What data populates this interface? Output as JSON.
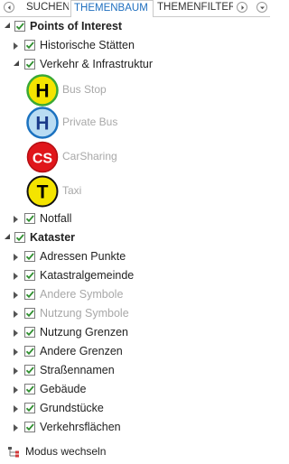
{
  "tabs": [
    {
      "label": "SUCHEN",
      "active": false
    },
    {
      "label": "THEMENBAUM",
      "active": true
    },
    {
      "label": "THEMENFILTER",
      "active": false
    }
  ],
  "tree": {
    "poi": {
      "label": "Points of Interest",
      "checked": true,
      "children": {
        "historic": {
          "label": "Historische Stätten",
          "checked": true
        },
        "traffic": {
          "label": "Verkehr & Infrastruktur",
          "checked": true,
          "legend": [
            {
              "symbol": "H",
              "label": "Bus Stop",
              "fill": "#f4e400",
              "ring": "#3aa935",
              "text_color": "#000000"
            },
            {
              "symbol": "H",
              "label": "Private Bus",
              "fill": "#b9dcf3",
              "ring": "#1b72c0",
              "text_color": "#1a3a8a"
            },
            {
              "symbol": "CS",
              "label": "CarSharing",
              "fill": "#e0161b",
              "ring": "#b50e12",
              "text_color": "#ffffff"
            },
            {
              "symbol": "T",
              "label": "Taxi",
              "fill": "#f4e400",
              "ring": "#111111",
              "text_color": "#000000"
            }
          ]
        },
        "emergency": {
          "label": "Notfall",
          "checked": true
        }
      }
    },
    "kataster": {
      "label": "Kataster",
      "checked": true,
      "children": [
        {
          "label": "Adressen Punkte",
          "checked": true,
          "disabled": false
        },
        {
          "label": "Katastralgemeinde",
          "checked": true,
          "disabled": false
        },
        {
          "label": "Andere Symbole",
          "checked": true,
          "disabled": true
        },
        {
          "label": "Nutzung Symbole",
          "checked": true,
          "disabled": true
        },
        {
          "label": "Nutzung Grenzen",
          "checked": true,
          "disabled": false
        },
        {
          "label": "Andere Grenzen",
          "checked": true,
          "disabled": false
        },
        {
          "label": "Straßennamen",
          "checked": true,
          "disabled": false
        },
        {
          "label": "Gebäude",
          "checked": true,
          "disabled": false
        },
        {
          "label": "Grundstücke",
          "checked": true,
          "disabled": false
        },
        {
          "label": "Verkehrsflächen",
          "checked": true,
          "disabled": false
        }
      ]
    }
  },
  "footer": {
    "label": "Modus wechseln",
    "icon": "tree-structure-icon"
  },
  "colors": {
    "accent": "#1f6fbf",
    "check": "#2f8f2f",
    "disabled_text": "#a8a8a8"
  }
}
